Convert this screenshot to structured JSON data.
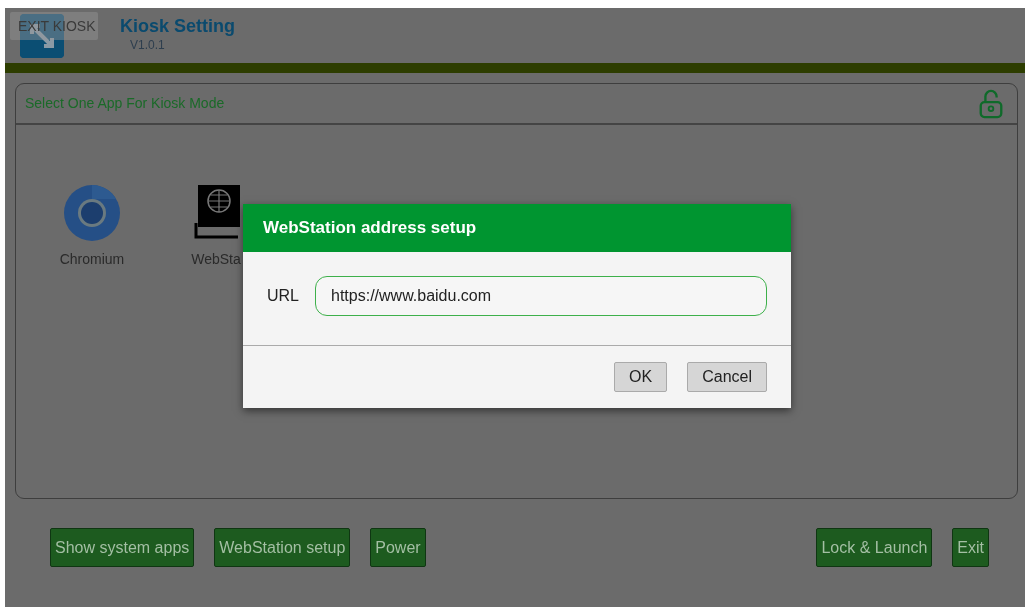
{
  "header": {
    "exit_button": "EXIT KIOSK",
    "title": "Kiosk Setting",
    "version": "V1.0.1"
  },
  "panel": {
    "title": "Select One App For Kiosk Mode",
    "locked": false,
    "apps": [
      {
        "name": "Chromium",
        "kind": "chromium"
      },
      {
        "name": "WebSta",
        "kind": "webstation"
      }
    ]
  },
  "left_buttons": [
    "Show system apps",
    "WebStation setup",
    "Power"
  ],
  "right_buttons": [
    "Lock & Launch",
    "Exit"
  ],
  "dialog": {
    "title": "WebStation address setup",
    "field": {
      "label": "URL",
      "value": "https://www.baidu.com"
    },
    "buttons": [
      "OK",
      "Cancel"
    ]
  }
}
